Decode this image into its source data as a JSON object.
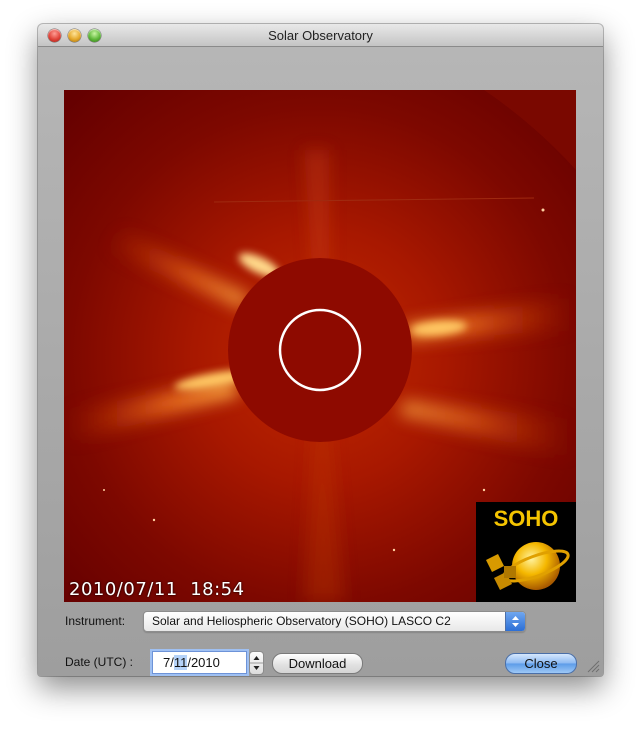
{
  "window": {
    "title": "Solar Observatory"
  },
  "image": {
    "timestamp": "2010/07/11  18:54",
    "logo_text": "SOHO"
  },
  "instrument": {
    "label": "Instrument:",
    "selected": "Solar and Heliospheric Observatory (SOHO) LASCO C2"
  },
  "date": {
    "label": "Date (UTC) :",
    "month": "7/",
    "day": "11",
    "year": "/2010"
  },
  "buttons": {
    "download": "Download",
    "close": "Close"
  },
  "icons": {
    "traffic_close": "close-icon",
    "traffic_minimize": "minimize-icon",
    "traffic_zoom": "zoom-icon",
    "stepper": "stepper-icon",
    "popup_arrows": "popup-arrows-icon",
    "resize_grip": "resize-grip-icon",
    "logo": "soho-logo"
  },
  "colors": {
    "default_button": "#5b9be8",
    "focus_ring": "#9fc0f2"
  }
}
